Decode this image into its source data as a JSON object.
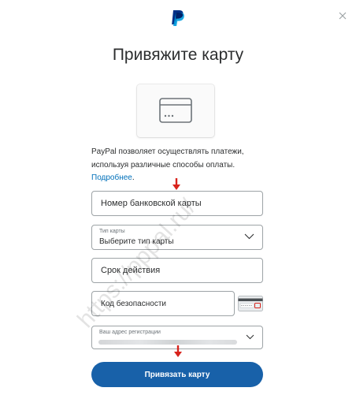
{
  "title": "Привяжите карту",
  "description": "PayPal позволяет осуществлять платежи, используя различные способы оплаты.",
  "learn_more": "Подробнее",
  "learn_more_suffix": ".",
  "fields": {
    "card_number": {
      "placeholder": "Номер банковской карты"
    },
    "card_type": {
      "label": "Тип карты",
      "value": "Выберите тип карты"
    },
    "expiry": {
      "placeholder": "Срок действия"
    },
    "security_code": {
      "placeholder": "Код безопасности"
    },
    "address": {
      "label": "Ваш адрес регистрации"
    }
  },
  "submit_label": "Привязать карту",
  "watermark": "https://pppal.ru/",
  "colors": {
    "brand_blue": "#1861a9",
    "link_blue": "#0070ba",
    "annotation_red": "#d8231c",
    "field_border": "#9da3a6"
  },
  "icons": [
    "paypal-logo",
    "close-icon",
    "credit-card-icon",
    "chevron-down-icon",
    "cvv-card-icon",
    "red-arrow-annotation"
  ]
}
